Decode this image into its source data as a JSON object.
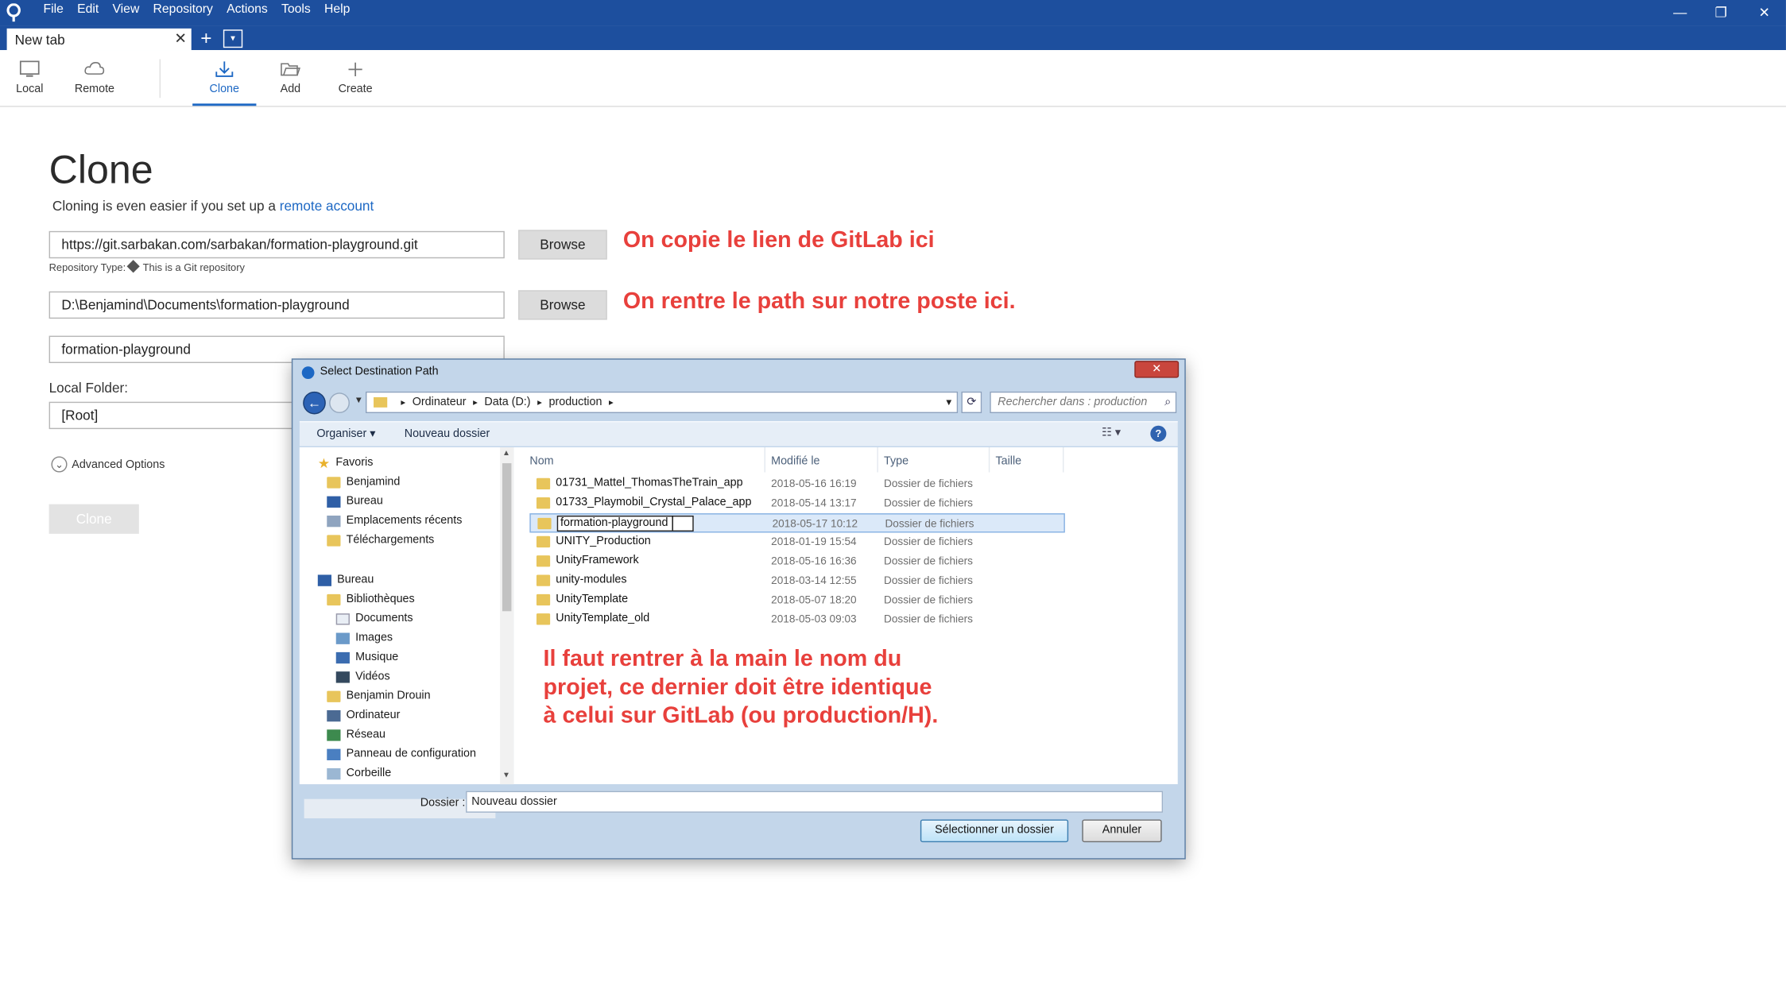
{
  "menu": [
    "File",
    "Edit",
    "View",
    "Repository",
    "Actions",
    "Tools",
    "Help"
  ],
  "window_controls": {
    "minimize": "—",
    "restore": "❐",
    "close": "✕"
  },
  "tab": {
    "label": "New tab",
    "close": "✕",
    "add": "+",
    "menu": "▾"
  },
  "toolbar": {
    "local": "Local",
    "remote": "Remote",
    "clone": "Clone",
    "add": "Add",
    "create": "Create"
  },
  "clone_page": {
    "title": "Clone",
    "subtitle_prefix": "Cloning is even easier if you set up a ",
    "subtitle_link": "remote account",
    "url_value": "https://git.sarbakan.com/sarbakan/formation-playground.git",
    "repo_type_label": "Repository Type:",
    "repo_type_value": "This is a Git repository",
    "path_value": "D:\\Benjamind\\Documents\\formation-playground",
    "name_value": "formation-playground",
    "local_folder_label": "Local Folder:",
    "local_folder_value": "[Root]",
    "browse_label": "Browse",
    "advanced_label": "Advanced Options",
    "clone_button": "Clone"
  },
  "annotations": {
    "a1": "On copie le lien de GitLab ici",
    "a2": "On rentre le path sur notre poste ici.",
    "a3_line1": "Il faut rentrer à la main le nom du",
    "a3_line2": "projet, ce dernier doit être identique",
    "a3_line3": "à celui sur GitLab (ou production/H)."
  },
  "dialog": {
    "title": "Select Destination Path",
    "close": "✕",
    "breadcrumb": [
      "Ordinateur",
      "Data (D:)",
      "production"
    ],
    "search_placeholder": "Rechercher dans : production",
    "organize": "Organiser ▾",
    "new_folder": "Nouveau dossier",
    "columns": {
      "name": "Nom",
      "modified": "Modifié le",
      "type": "Type",
      "size": "Taille"
    },
    "tree": {
      "favoris": "Favoris",
      "benjamind": "Benjamind",
      "bureau": "Bureau",
      "recent": "Emplacements récents",
      "downloads": "Téléchargements",
      "bureau2": "Bureau",
      "libs": "Bibliothèques",
      "documents": "Documents",
      "images": "Images",
      "music": "Musique",
      "videos": "Vidéos",
      "user": "Benjamin Drouin",
      "computer": "Ordinateur",
      "network": "Réseau",
      "panel": "Panneau de configuration",
      "bin": "Corbeille"
    },
    "rows": [
      {
        "name": "01731_Mattel_ThomasTheTrain_app",
        "date": "2018-05-16 16:19",
        "type": "Dossier de fichiers"
      },
      {
        "name": "01733_Playmobil_Crystal_Palace_app",
        "date": "2018-05-14 13:17",
        "type": "Dossier de fichiers"
      },
      {
        "name": "formation-playground",
        "date": "2018-05-17 10:12",
        "type": "Dossier de fichiers"
      },
      {
        "name": "UNITY_Production",
        "date": "2018-01-19 15:54",
        "type": "Dossier de fichiers"
      },
      {
        "name": "UnityFramework",
        "date": "2018-05-16 16:36",
        "type": "Dossier de fichiers"
      },
      {
        "name": "unity-modules",
        "date": "2018-03-14 12:55",
        "type": "Dossier de fichiers"
      },
      {
        "name": "UnityTemplate",
        "date": "2018-05-07 18:20",
        "type": "Dossier de fichiers"
      },
      {
        "name": "UnityTemplate_old",
        "date": "2018-05-03 09:03",
        "type": "Dossier de fichiers"
      }
    ],
    "folder_label": "Dossier :",
    "folder_value": "Nouveau dossier",
    "select_button": "Sélectionner un dossier",
    "cancel_button": "Annuler"
  },
  "colors": {
    "titlebar": "#1d4f9e",
    "accent": "#1d68c4",
    "annotation": "#e8403c"
  }
}
